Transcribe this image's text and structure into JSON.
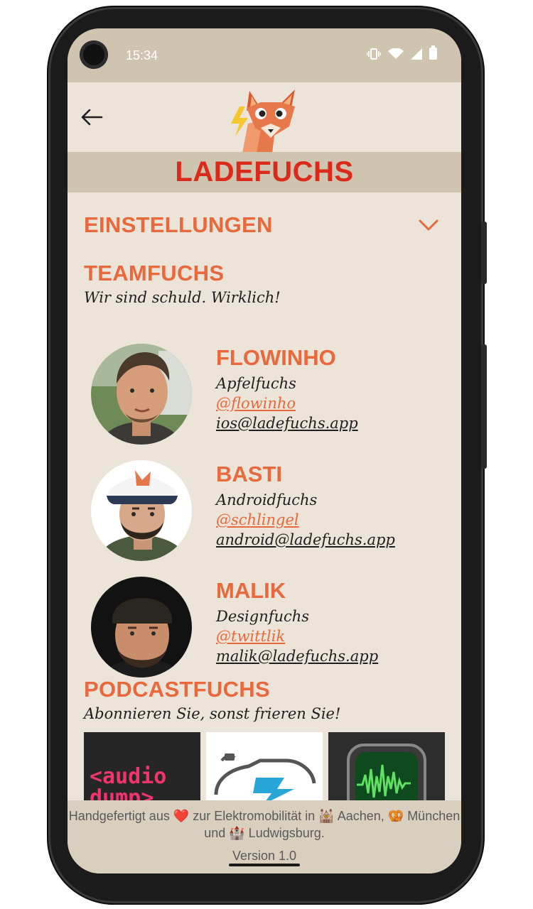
{
  "status": {
    "time": "15:34"
  },
  "app": {
    "title": "LADEFUCHS"
  },
  "settings": {
    "label": "EINSTELLUNGEN"
  },
  "team": {
    "heading": "TEAMFUCHS",
    "subtitle": "Wir sind schuld. Wirklich!",
    "members": [
      {
        "name": "FLOWINHO",
        "role": "Apfelfuchs",
        "handle": "@flowinho",
        "email": "ios@ladefuchs.app"
      },
      {
        "name": "BASTI",
        "role": "Androidfuchs",
        "handle": "@schlingel",
        "email": "android@ladefuchs.app"
      },
      {
        "name": "MALIK",
        "role": "Designfuchs",
        "handle": "@twittlik",
        "email": "malik@ladefuchs.app"
      }
    ]
  },
  "podcast": {
    "heading": "PODCASTFUCHS",
    "subtitle": "Abonnieren Sie, sonst frieren Sie!",
    "tiles": [
      {
        "text": "<audio dump>"
      }
    ]
  },
  "footer": {
    "credit": "Handgefertigt aus ❤️ zur Elektromobilität in 🕍 Aachen, 🥨 München und 🏰 Ludwigsburg.",
    "version": "Version 1.0"
  },
  "icons": {
    "back": "arrow-left-icon",
    "expand": "chevron-down-icon",
    "logo": "fox-logo"
  },
  "colors": {
    "brand_red": "#DB2A1A",
    "accent_orange": "#E8693C",
    "background": "#ECE4D8",
    "header_band": "#CFC4B0"
  }
}
